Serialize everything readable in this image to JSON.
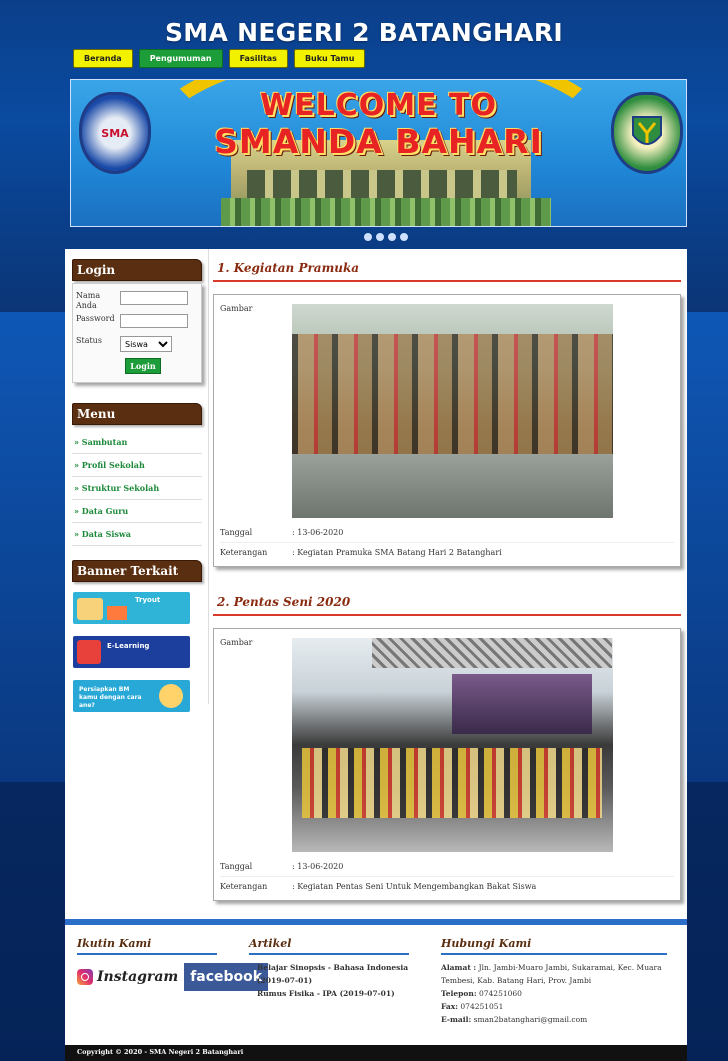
{
  "site": {
    "title": "SMA NEGERI 2 BATANGHARI"
  },
  "nav": [
    {
      "label": "Beranda",
      "active": false
    },
    {
      "label": "Pengumuman",
      "active": true
    },
    {
      "label": "Fasilitas",
      "active": false
    },
    {
      "label": "Buku Tamu",
      "active": false
    }
  ],
  "banner": {
    "line1": "WELCOME TO",
    "line2": "SMANDA BAHARI",
    "logo_left": "SMA",
    "slide_count": 4
  },
  "login": {
    "title": "Login",
    "name_label": "Nama Anda",
    "password_label": "Password",
    "status_label": "Status",
    "status_value": "Siswa",
    "button": "Login"
  },
  "menu": {
    "title": "Menu",
    "items": [
      "» Sambutan",
      "» Profil Sekolah",
      "» Struktur Sekolah",
      "» Data Guru",
      "» Data Siswa"
    ]
  },
  "banners": {
    "title": "Banner Terkait",
    "tiles": [
      {
        "name": "tryout",
        "text": "Tryout",
        "color": "#2fb4d8"
      },
      {
        "name": "e-learning",
        "text": "E-Learning",
        "color": "#1c3f9e"
      },
      {
        "name": "persiapan",
        "text": "Persiapkan BM kamu dengan cara ane?",
        "color": "#27a8d6"
      }
    ]
  },
  "posts": [
    {
      "title": "1. Kegiatan Pramuka",
      "gambar_label": "Gambar",
      "tanggal_label": "Tanggal",
      "tanggal": ": 13-06-2020",
      "keterangan_label": "Keterangan",
      "keterangan": ": Kegiatan Pramuka SMA Batang Hari 2 Batanghari"
    },
    {
      "title": "2. Pentas Seni 2020",
      "gambar_label": "Gambar",
      "tanggal_label": "Tanggal",
      "tanggal": ": 13-06-2020",
      "keterangan_label": "Keterangan",
      "keterangan": ": Kegiatan Pentas Seni Untuk Mengembangkan Bakat Siswa"
    }
  ],
  "footer": {
    "follow_title": "Ikutin Kami",
    "instagram": "Instagram",
    "facebook": "facebook",
    "artikel_title": "Artikel",
    "artikel": [
      "Belajar Sinopsis - Bahasa Indonesia (2019-07-01)",
      "Rumus Fisika - IPA (2019-07-01)"
    ],
    "hubungi_title": "Hubungi Kami",
    "alamat_label": "Alamat :",
    "alamat": "Jln. Jambi-Muaro Jambi, Sukaramai, Kec. Muara Tembesi, Kab. Batang Hari, Prov. Jambi",
    "telepon_label": "Telepon:",
    "telepon": "074251060",
    "fax_label": "Fax:",
    "fax": "074251051",
    "email_label": "E-mail:",
    "email": "sman2batanghari@gmail.com",
    "copyright": "Copyright © 2020 - SMA Negeri 2 Batanghari"
  }
}
